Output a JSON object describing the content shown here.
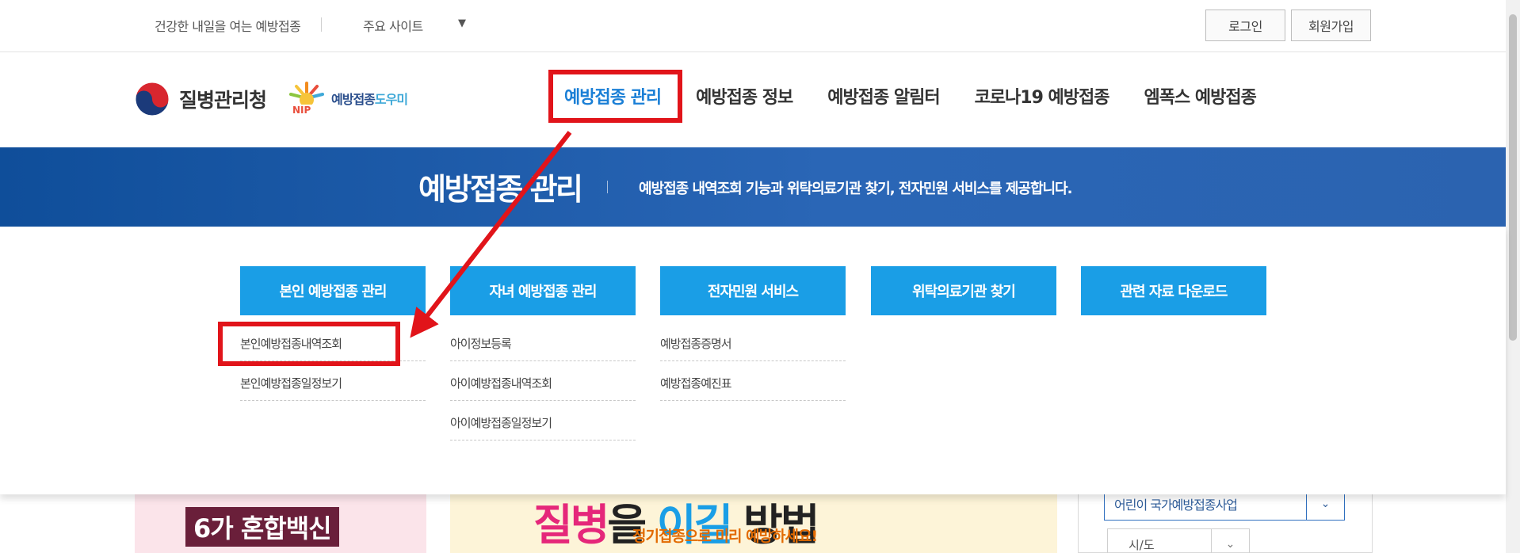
{
  "util_bar": {
    "tagline": "건강한 내일을 여는 예방접종",
    "sites_label": "주요 사이트",
    "sites_caret": "▼",
    "login": "로그인",
    "join": "회원가입"
  },
  "header": {
    "kdca_name": "질병관리청",
    "ntp_name_main": "예방접종",
    "ntp_name_sub": "도우미",
    "ntp_badge": "NIP",
    "gnb": [
      {
        "label": "예방접종 관리"
      },
      {
        "label": "예방접종 정보"
      },
      {
        "label": "예방접종 알림터"
      },
      {
        "label": "코로나19 예방접종"
      },
      {
        "label": "엠폭스 예방접종"
      }
    ]
  },
  "banner": {
    "title": "예방접종 관리",
    "description": "예방접종 내역조회 기능과 위탁의료기관 찾기, 전자민원 서비스를 제공합니다."
  },
  "mega_menu": {
    "columns": [
      {
        "head": "본인 예방접종 관리",
        "items": [
          "본인예방접종내역조회",
          "본인예방접종일정보기"
        ]
      },
      {
        "head": "자녀 예방접종 관리",
        "items": [
          "아이정보등록",
          "아이예방접종내역조회",
          "아이예방접종일정보기"
        ]
      },
      {
        "head": "전자민원 서비스",
        "items": [
          "예방접종증명서",
          "예방접종예진표"
        ]
      },
      {
        "head": "위탁의료기관 찾기",
        "items": []
      },
      {
        "head": "관련 자료 다운로드",
        "items": []
      }
    ]
  },
  "background": {
    "promo1_badge": "6가 혼합백신",
    "promo2_head_1": "질병",
    "promo2_head_2": "을 ",
    "promo2_head_3": "이길",
    "promo2_head_4": " 방법",
    "promo2_sub_prefix": "정기접종으로 미리 예방하세요!",
    "side_select_label": "어린이 국가예방접종사업",
    "side_select2_label": "시/도"
  },
  "colors": {
    "brand_blue": "#1a9ee6",
    "banner_blue": "#1f5aa8",
    "active_menu": "#1a7fd6",
    "annotation_red": "#e1141a"
  }
}
